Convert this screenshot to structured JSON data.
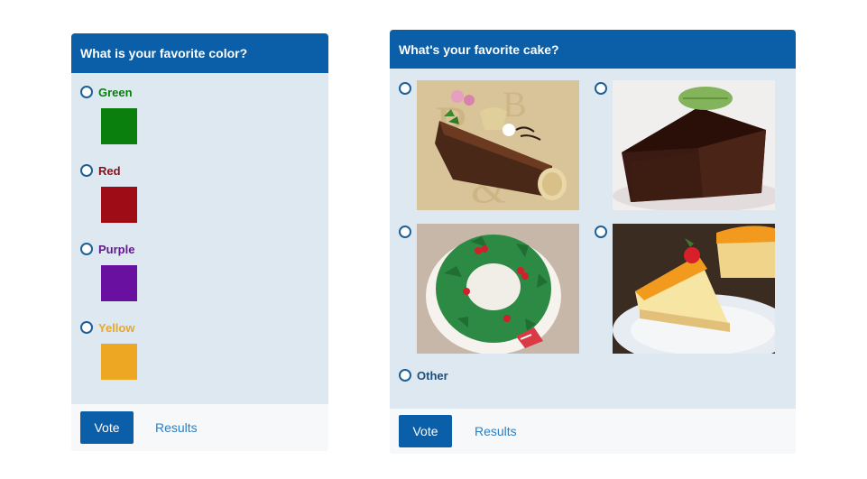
{
  "poll_color": {
    "title": "What is your favorite color?",
    "options": [
      {
        "label": "Green",
        "color": "#0a7f0e"
      },
      {
        "label": "Red",
        "color": "#9e0c16"
      },
      {
        "label": "Purple",
        "color": "#6a10a0"
      },
      {
        "label": "Yellow",
        "color": "#eea723"
      }
    ],
    "vote_label": "Vote",
    "results_label": "Results"
  },
  "poll_cake": {
    "title": "What's your favorite cake?",
    "options": [
      {
        "image": "yule-log-cake"
      },
      {
        "image": "chocolate-cake-slice"
      },
      {
        "image": "holly-wreath-cake"
      },
      {
        "image": "mango-cheesecake-slice"
      }
    ],
    "other_label": "Other",
    "vote_label": "Vote",
    "results_label": "Results"
  },
  "colors": {
    "accent": "#0b5ea8",
    "panel_bg": "#dde8f1",
    "link": "#2a7fc4"
  }
}
